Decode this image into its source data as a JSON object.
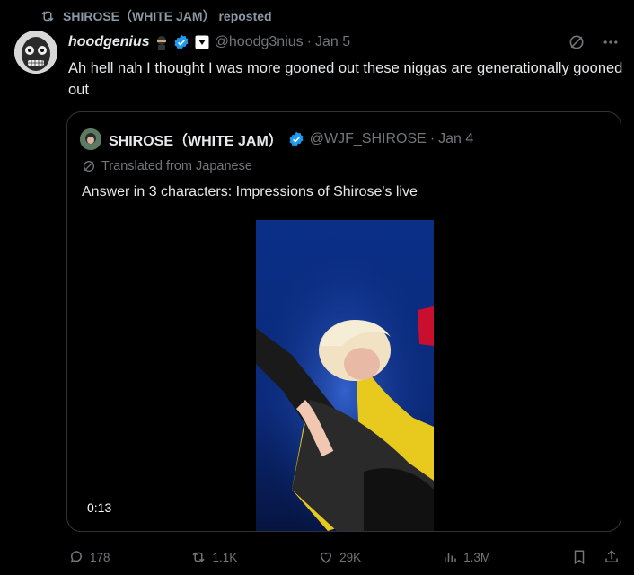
{
  "repost": {
    "icon": "repost-icon",
    "label": "SHIROSE（WHITE JAM） reposted"
  },
  "tweet": {
    "author": {
      "display_name": "hoodgenius",
      "handle": "@hoodg3nius",
      "verified": true,
      "affiliation_badge": "affiliate-badge-icon"
    },
    "date": "Jan 5",
    "text": "Ah hell nah I thought I was more gooned out these niggas are generationally gooned out"
  },
  "quoted": {
    "author": {
      "display_name": "SHIROSE（WHITE JAM）",
      "handle": "@WJF_SHIROSE",
      "verified": true
    },
    "date": "Jan 4",
    "translated_label": "Translated from Japanese",
    "text": "Answer in 3 characters: Impressions of Shirose's live",
    "video": {
      "timestamp": "0:13"
    }
  },
  "actions": {
    "replies": "178",
    "reposts": "1.1K",
    "likes": "29K",
    "views": "1.3M"
  },
  "colors": {
    "background": "#000000",
    "text": "#e7e9ea",
    "muted": "#71767b",
    "verified": "#1d9bf0",
    "border": "#2f3336"
  }
}
